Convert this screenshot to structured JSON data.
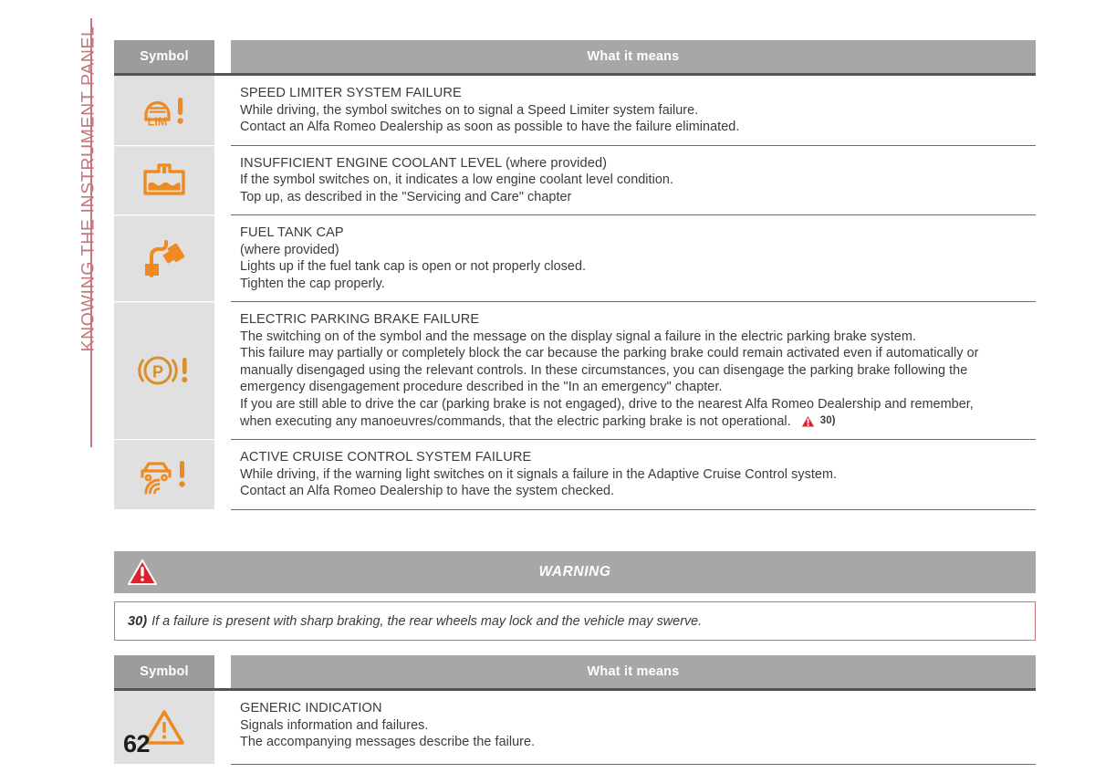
{
  "chapter_tab": {
    "label": "KNOWING THE INSTRUMENT PANEL",
    "color": "#c9757e"
  },
  "colors": {
    "symbol_orange": "#ef8a22",
    "warning_red": "#d9232e",
    "header_gray": "#a7a7a7",
    "rule_gray": "#6c6c6c"
  },
  "table_one": {
    "headers": {
      "symbol": "Symbol",
      "meaning": "What it means"
    },
    "rows": [
      {
        "icon": "speed-limiter-failure-icon",
        "title": "SPEED LIMITER SYSTEM FAILURE",
        "lines": [
          "While driving, the symbol switches on to signal a Speed Limiter system failure.",
          "Contact an Alfa Romeo Dealership as soon as possible to have the failure eliminated."
        ]
      },
      {
        "icon": "engine-coolant-level-icon",
        "title": "INSUFFICIENT ENGINE COOLANT LEVEL (where provided)",
        "lines": [
          "If the symbol switches on, it indicates a low engine coolant level condition.",
          "Top up, as described in the \"Servicing and Care\" chapter"
        ]
      },
      {
        "icon": "fuel-tank-cap-icon",
        "title": "FUEL TANK CAP",
        "lines": [
          "(where provided)",
          "Lights up if the fuel tank cap is open or not properly closed.",
          "Tighten the cap properly."
        ]
      },
      {
        "icon": "electric-parking-brake-failure-icon",
        "title": "ELECTRIC PARKING BRAKE FAILURE",
        "lines": [
          "The switching on of the symbol and the message on the display signal a failure in the electric parking brake system.",
          "This failure may partially or completely block the car because the parking brake could remain activated even if automatically or",
          "manually disengaged using the relevant controls. In these circumstances, you can disengage the parking brake following the",
          "emergency disengagement procedure described in the \"In an emergency\" chapter.",
          "If you are still able to drive the car (parking brake is not engaged), drive to the nearest Alfa Romeo Dealership and remember,"
        ],
        "last_line": "when executing any manoeuvres/commands, that the electric parking brake is not operational.",
        "footnote_ref": "30)"
      },
      {
        "icon": "adaptive-cruise-control-failure-icon",
        "title": "ACTIVE CRUISE CONTROL SYSTEM FAILURE",
        "lines": [
          "While driving, if the warning light switches on it signals a failure in the Adaptive Cruise Control system.",
          "Contact an Alfa Romeo Dealership to have the system checked."
        ]
      }
    ]
  },
  "warning_block": {
    "title": "WARNING",
    "icon": "warning-triangle-red-icon",
    "note_number": "30)",
    "note_text": "If a failure is present with sharp braking, the rear wheels may lock and the vehicle may swerve."
  },
  "table_two": {
    "headers": {
      "symbol": "Symbol",
      "meaning": "What it means"
    },
    "rows": [
      {
        "icon": "generic-indication-triangle-icon",
        "title": "GENERIC INDICATION",
        "lines": [
          "Signals information and failures.",
          "The accompanying messages describe the failure."
        ]
      }
    ]
  },
  "page_number": "62"
}
